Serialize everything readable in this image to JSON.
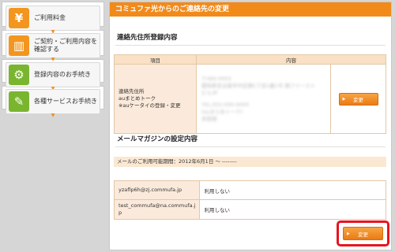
{
  "sidebar": {
    "items": [
      {
        "label": "ご利用料金",
        "icon": "yen-icon",
        "glyph": "¥",
        "color": "orange"
      },
      {
        "label_line1": "ご契約・ご利用内容を",
        "label_line2": "確認する",
        "icon": "book-icon",
        "glyph": "▥",
        "color": "orange"
      },
      {
        "label": "登録内容のお手続き",
        "icon": "gears-icon",
        "glyph": "⚙",
        "color": "green"
      },
      {
        "label": "各種サービスお手続き",
        "icon": "checklist-icon",
        "glyph": "✎",
        "color": "green"
      }
    ]
  },
  "main": {
    "title": "コミュファ光からのご連絡先の変更",
    "contact_section": {
      "heading": "連絡先住所登録内容",
      "col_item": "項目",
      "col_content": "内容",
      "row_label_1": "連絡先住所",
      "row_label_2": "auまとめトーク",
      "row_label_3": "※auケータイの登録・変更",
      "blurred_lines": [
        "〒460-0003",
        "愛知県名古屋市中区錦1丁目1番1号 錦ファースト",
        "ビル3F",
        "",
        "TEL:052-000-0000",
        "(auまとめトーク)",
        "未登録"
      ],
      "change_button": "変更"
    },
    "magazine_section": {
      "heading": "メールマガジンの設定内容",
      "period": "メールのご利用可能期間：2012年6月1日 ～ --------",
      "rows": [
        {
          "address": "yzaflp6h@zj.commufa.jp",
          "status": "利用しない"
        },
        {
          "address_line1": "test_commufa@na.commufa.j",
          "address_line2": "p",
          "status": "利用しない"
        }
      ],
      "change_button": "変更"
    }
  },
  "colors": {
    "accent": "#f28a1a",
    "highlight": "#e8141e",
    "table_header": "#fae0c4",
    "icon_green": "#7ab52f"
  }
}
